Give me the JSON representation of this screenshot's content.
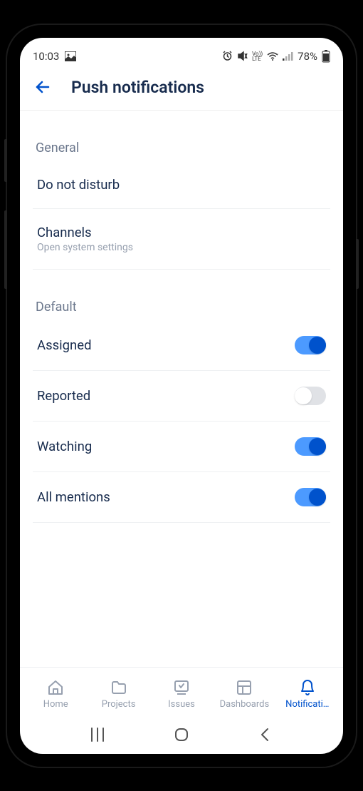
{
  "status": {
    "time": "10:03",
    "battery": "78%"
  },
  "header": {
    "title": "Push notifications"
  },
  "sections": {
    "general_label": "General",
    "default_label": "Default"
  },
  "settings": {
    "dnd": {
      "label": "Do not disturb"
    },
    "channels": {
      "label": "Channels",
      "sublabel": "Open system settings"
    },
    "assigned": {
      "label": "Assigned",
      "enabled": true
    },
    "reported": {
      "label": "Reported",
      "enabled": false
    },
    "watching": {
      "label": "Watching",
      "enabled": true
    },
    "mentions": {
      "label": "All mentions",
      "enabled": true
    }
  },
  "nav": {
    "home": "Home",
    "projects": "Projects",
    "issues": "Issues",
    "dashboards": "Dashboards",
    "notifications": "Notificati…"
  }
}
